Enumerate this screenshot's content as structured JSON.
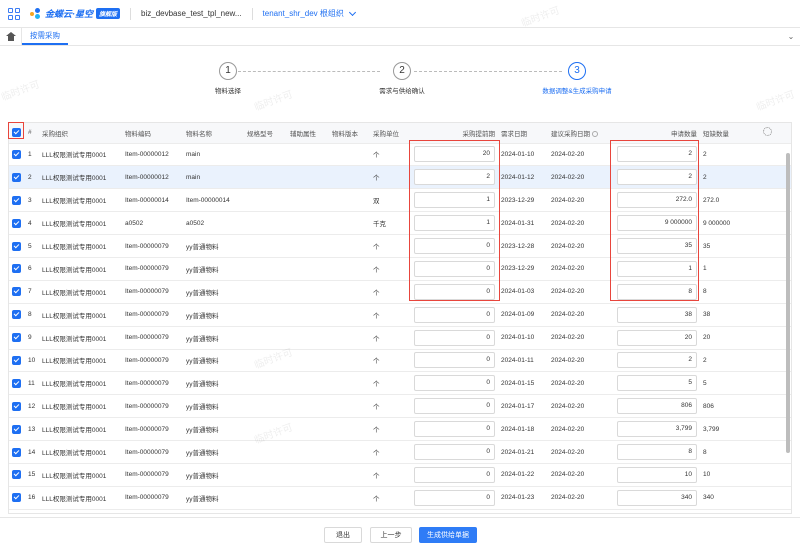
{
  "header": {
    "brand": "金蝶云·星空",
    "badge": "旗舰版",
    "project": "biz_devbase_test_tpl_new...",
    "tenant": "tenant_shr_dev 根组织"
  },
  "tabbar": {
    "tab": "按需采购"
  },
  "steps": [
    {
      "num": "1",
      "label": "物料选择"
    },
    {
      "num": "2",
      "label": "需求与供给确认"
    },
    {
      "num": "3",
      "label": "数据调整&生成采购申请"
    }
  ],
  "watermark": "临时许可",
  "table": {
    "columns": [
      "#",
      "采购组织",
      "物料编码",
      "物料名称",
      "规格型号",
      "辅助属性",
      "物料版本",
      "采购单位",
      "采购提前期",
      "需求日期",
      "建议采购日期",
      "申请数量",
      "短缺数量"
    ],
    "rows": [
      {
        "no": "1",
        "org": "LLL权限测试专用0001",
        "code": "Item-00000012",
        "name": "main",
        "unit": "个",
        "lead": "20",
        "req": "2024-01-10",
        "sug": "2024-02-20",
        "qty": "2",
        "short": "2"
      },
      {
        "no": "2",
        "org": "LLL权限测试专用0001",
        "code": "Item-00000012",
        "name": "main",
        "unit": "个",
        "lead": "2",
        "req": "2024-01-12",
        "sug": "2024-02-20",
        "qty": "2",
        "short": "2"
      },
      {
        "no": "3",
        "org": "LLL权限测试专用0001",
        "code": "Item-00000014",
        "name": "Item-00000014",
        "unit": "双",
        "lead": "1",
        "req": "2023-12-29",
        "sug": "2024-02-20",
        "qty": "272.0",
        "short": "272.0"
      },
      {
        "no": "4",
        "org": "LLL权限测试专用0001",
        "code": "a0502",
        "name": "a0502",
        "unit": "千克",
        "lead": "1",
        "req": "2024-01-31",
        "sug": "2024-02-20",
        "qty": "9 000000",
        "short": "9 000000"
      },
      {
        "no": "5",
        "org": "LLL权限测试专用0001",
        "code": "Item-00000079",
        "name": "yy普通物料",
        "unit": "个",
        "lead": "0",
        "req": "2023-12-28",
        "sug": "2024-02-20",
        "qty": "35",
        "short": "35"
      },
      {
        "no": "6",
        "org": "LLL权限测试专用0001",
        "code": "Item-00000079",
        "name": "yy普通物料",
        "unit": "个",
        "lead": "0",
        "req": "2023-12-29",
        "sug": "2024-02-20",
        "qty": "1",
        "short": "1"
      },
      {
        "no": "7",
        "org": "LLL权限测试专用0001",
        "code": "Item-00000079",
        "name": "yy普通物料",
        "unit": "个",
        "lead": "0",
        "req": "2024-01-03",
        "sug": "2024-02-20",
        "qty": "8",
        "short": "8"
      },
      {
        "no": "8",
        "org": "LLL权限测试专用0001",
        "code": "Item-00000079",
        "name": "yy普通物料",
        "unit": "个",
        "lead": "0",
        "req": "2024-01-09",
        "sug": "2024-02-20",
        "qty": "38",
        "short": "38"
      },
      {
        "no": "9",
        "org": "LLL权限测试专用0001",
        "code": "Item-00000079",
        "name": "yy普通物料",
        "unit": "个",
        "lead": "0",
        "req": "2024-01-10",
        "sug": "2024-02-20",
        "qty": "20",
        "short": "20"
      },
      {
        "no": "10",
        "org": "LLL权限测试专用0001",
        "code": "Item-00000079",
        "name": "yy普通物料",
        "unit": "个",
        "lead": "0",
        "req": "2024-01-11",
        "sug": "2024-02-20",
        "qty": "2",
        "short": "2"
      },
      {
        "no": "11",
        "org": "LLL权限测试专用0001",
        "code": "Item-00000079",
        "name": "yy普通物料",
        "unit": "个",
        "lead": "0",
        "req": "2024-01-15",
        "sug": "2024-02-20",
        "qty": "5",
        "short": "5"
      },
      {
        "no": "12",
        "org": "LLL权限测试专用0001",
        "code": "Item-00000079",
        "name": "yy普通物料",
        "unit": "个",
        "lead": "0",
        "req": "2024-01-17",
        "sug": "2024-02-20",
        "qty": "806",
        "short": "806"
      },
      {
        "no": "13",
        "org": "LLL权限测试专用0001",
        "code": "Item-00000079",
        "name": "yy普通物料",
        "unit": "个",
        "lead": "0",
        "req": "2024-01-18",
        "sug": "2024-02-20",
        "qty": "3,799",
        "short": "3,799"
      },
      {
        "no": "14",
        "org": "LLL权限测试专用0001",
        "code": "Item-00000079",
        "name": "yy普通物料",
        "unit": "个",
        "lead": "0",
        "req": "2024-01-21",
        "sug": "2024-02-20",
        "qty": "8",
        "short": "8"
      },
      {
        "no": "15",
        "org": "LLL权限测试专用0001",
        "code": "Item-00000079",
        "name": "yy普通物料",
        "unit": "个",
        "lead": "0",
        "req": "2024-01-22",
        "sug": "2024-02-20",
        "qty": "10",
        "short": "10"
      },
      {
        "no": "16",
        "org": "LLL权限测试专用0001",
        "code": "Item-00000079",
        "name": "yy普通物料",
        "unit": "个",
        "lead": "0",
        "req": "2024-01-23",
        "sug": "2024-02-20",
        "qty": "340",
        "short": "340"
      }
    ]
  },
  "footer": {
    "exit": "退出",
    "prev": "上一步",
    "generate": "生成供给单据"
  },
  "colors": {
    "accent": "#1e6ff2",
    "highlight": "#e8453c",
    "selected_row": "#eaf2fd"
  }
}
